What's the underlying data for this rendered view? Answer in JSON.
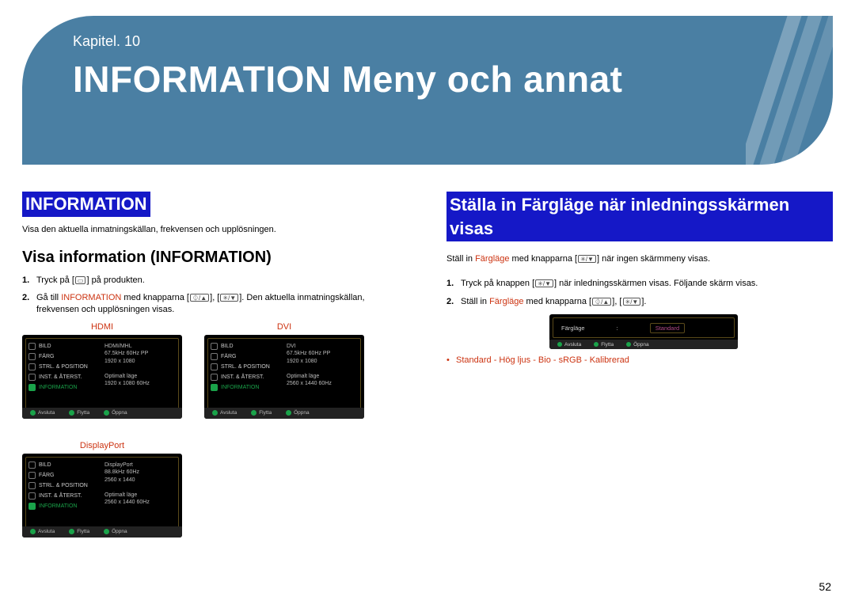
{
  "banner": {
    "chapter": "Kapitel. 10",
    "title": "INFORMATION Meny och annat"
  },
  "left": {
    "heading": "INFORMATION",
    "lead": "Visa den aktuella inmatningskällan, frekvensen och upplösningen.",
    "subheading": "Visa information (INFORMATION)",
    "steps": [
      {
        "pre": "Tryck på [",
        "icon": "m",
        "post": "] på produkten."
      },
      {
        "pre": "Gå till ",
        "kw": "INFORMATION",
        "mid": " med knapparna [",
        "icon1": "⏀/▲",
        "mid2": "], [",
        "icon2": "✳/▼",
        "post": "]. Den aktuella inmatningskällan, frekvensen och upplösningen visas."
      }
    ],
    "thumbs": [
      {
        "label": "HDMI",
        "menu": [
          "BILD",
          "FÄRG",
          "STRL. & POSITION",
          "INST. & ÅTERST.",
          "INFORMATION"
        ],
        "info": [
          "HDMI/MHL",
          "67.5kHz  60Hz  PP",
          "1920 x 1080",
          "",
          "Optimalt läge",
          "1920 x 1080   60Hz"
        ]
      },
      {
        "label": "DVI",
        "menu": [
          "BILD",
          "FÄRG",
          "STRL. & POSITION",
          "INST. & ÅTERST.",
          "INFORMATION"
        ],
        "info": [
          "DVI",
          "67.5kHz 60Hz PP",
          "1920 x 1080",
          "",
          "Optimalt läge",
          "2560 x 1440   60Hz"
        ]
      },
      {
        "label": "DisplayPort",
        "menu": [
          "BILD",
          "FÄRG",
          "STRL. & POSITION",
          "INST. & ÅTERST.",
          "INFORMATION"
        ],
        "info": [
          "DisplayPort",
          "88.8kHz 60Hz",
          "2560 x 1440",
          "",
          "Optimalt läge",
          "2560 x 1440   60Hz"
        ]
      }
    ],
    "footer": [
      "Avsluta",
      "Flytta",
      "Öppna"
    ]
  },
  "right": {
    "heading": "Ställa in Färgläge när inledningsskärmen visas",
    "lead_pre": "Ställ in ",
    "lead_kw": "Färgläge",
    "lead_mid": " med knapparna [",
    "lead_icon": "✳/▼",
    "lead_post": "] när ingen skärmmeny visas.",
    "steps": [
      {
        "pre": "Tryck på knappen [",
        "icon": "✳/▼",
        "post": "] när inledningsskärmen visas. Följande skärm visas."
      },
      {
        "pre": "Ställ in ",
        "kw": "Färgläge",
        "mid": " med knapparna [",
        "icon1": "⏀/▲",
        "mid2": "], [",
        "icon2": "✳/▼",
        "post": "]."
      }
    ],
    "mini": {
      "label": "Färgläge",
      "value": "Standard",
      "footer": [
        "Avsluta",
        "Flytta",
        "Öppna"
      ]
    },
    "bullet": "Standard - Hög ljus - Bio - sRGB - Kalibrerad"
  },
  "page_number": "52"
}
